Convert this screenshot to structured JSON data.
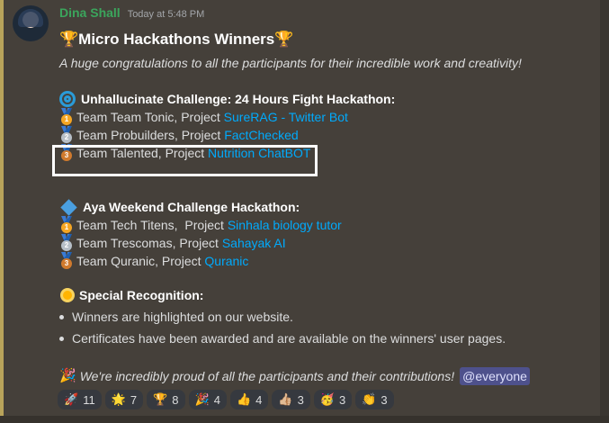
{
  "message": {
    "username": "Dina Shall",
    "timestamp": "Today at 5:48 PM",
    "title": "Micro Hackathons Winners",
    "subtitle": "A huge congratulations to all the participants for their incredible work and creativity!",
    "section1": {
      "heading": "Unhallucinate Challenge: 24 Hours Fight Hackathon:",
      "rows": [
        {
          "medal": "1",
          "prefix": "Team Team Tonic, Project ",
          "link": "SureRAG - Twitter Bot"
        },
        {
          "medal": "2",
          "prefix": "Team Probuilders, Project ",
          "link": "FactChecked"
        },
        {
          "medal": "3",
          "prefix": "Team Talented, Project ",
          "link": "Nutrition ChatBOT"
        }
      ]
    },
    "section2": {
      "heading": "Aya Weekend Challenge Hackathon:",
      "rows": [
        {
          "medal": "1",
          "prefix": "Team Tech Titens,  Project ",
          "link": "Sinhala biology tutor"
        },
        {
          "medal": "2",
          "prefix": "Team Trescomas, Project ",
          "link": "Sahayak AI"
        },
        {
          "medal": "3",
          "prefix": "Team Quranic, Project ",
          "link": "Quranic"
        }
      ]
    },
    "section3": {
      "heading": "Special Recognition:",
      "bullets": [
        "Winners are highlighted on our website.",
        "Certificates have been awarded and are available on the winners' user pages."
      ]
    },
    "closing": "We're incredibly proud of all the participants and their contributions!",
    "mention": "@everyone",
    "trophy_emoji": "🏆",
    "party_emoji": "🎉"
  },
  "reactions": [
    {
      "emoji": "🚀",
      "count": "11"
    },
    {
      "emoji": "🌟",
      "count": "7"
    },
    {
      "emoji": "🏆",
      "count": "8"
    },
    {
      "emoji": "🎉",
      "count": "4"
    },
    {
      "emoji": "👍",
      "count": "4"
    },
    {
      "emoji": "👍🏼",
      "count": "3"
    },
    {
      "emoji": "🥳",
      "count": "3"
    },
    {
      "emoji": "👏",
      "count": "3"
    }
  ]
}
